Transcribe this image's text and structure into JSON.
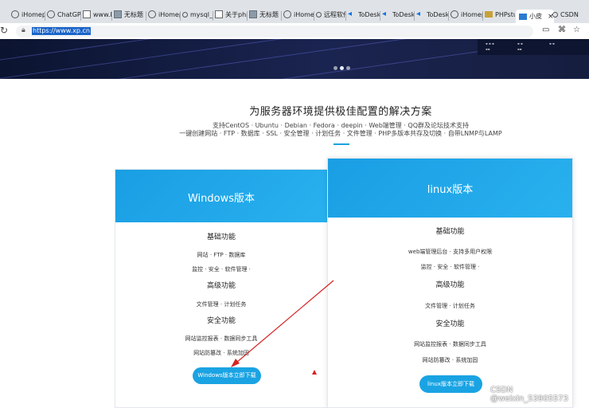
{
  "browser": {
    "tabs": [
      {
        "label": "iHomep",
        "icon": "globe-icon"
      },
      {
        "label": "ChatGPT",
        "icon": "chat-icon"
      },
      {
        "label": "www.bo",
        "icon": "page-icon"
      },
      {
        "label": "无标题",
        "icon": "image-icon"
      },
      {
        "label": "iHomep",
        "icon": "globe-icon"
      },
      {
        "label": "mysql_l",
        "icon": "search-icon"
      },
      {
        "label": "关于php",
        "icon": "page-icon"
      },
      {
        "label": "无标题",
        "icon": "image-icon"
      },
      {
        "label": "iHomep",
        "icon": "globe-icon"
      },
      {
        "label": "远程软件",
        "icon": "search-icon"
      },
      {
        "label": "ToDesk",
        "icon": "todesk-icon"
      },
      {
        "label": "ToDesk",
        "icon": "todesk-icon"
      },
      {
        "label": "ToDesk",
        "icon": "todesk-icon"
      },
      {
        "label": "iHomep",
        "icon": "globe-icon"
      },
      {
        "label": "PHPstud",
        "icon": "folder-icon"
      },
      {
        "label": "小皮",
        "icon": "php-icon",
        "active": true
      },
      {
        "label": "CSDN",
        "icon": "search-icon"
      }
    ],
    "close_tab": "×",
    "url": "https://www.xp.cn"
  },
  "hero": {
    "title": "为服务器环境提供极佳配置的解决方案",
    "subtitle_1": "支持CentOS · Ubuntu · Debian · Fedora · deepin · Web端管理 · QQ群及论坛技术支持",
    "subtitle_2": "一键创建网站 · FTP · 数据库 · SSL · 安全管理 · 计划任务 · 文件管理 · PHP多版本共存及切换 · 自带LNMP与LAMP"
  },
  "windows_card": {
    "title": "Windows版本",
    "basic_heading": "基础功能",
    "basic_1": "网站 · FTP · 数据库",
    "basic_2": "监控 · 安全 · 软件管理 ·",
    "adv_heading": "高级功能",
    "adv_1": "文件管理 · 计划任务",
    "sec_heading": "安全功能",
    "sec_1": "网站监控报表 · 数据同步工具",
    "sec_2": "网站防篡改 · 系统加固",
    "button": "Windows版本立即下载"
  },
  "linux_card": {
    "title": "linux版本",
    "basic_heading": "基础功能",
    "basic_1": "web端管理后台 · 支持多用户权限",
    "basic_2": "监控 · 安全 · 软件管理 ·",
    "adv_heading": "高级功能",
    "adv_1": "文件管理 · 计划任务",
    "sec_heading": "安全功能",
    "sec_1": "网站监控报表 · 数据同步工具",
    "sec_2": "网站防篡改 · 系统加固",
    "button": "linux版本立即下载"
  },
  "watermark": "CSDN @weixin_53905573",
  "colors": {
    "accent": "#1aa1e0",
    "annotation_arrow": "#d62222",
    "banner": "#111a3a"
  }
}
